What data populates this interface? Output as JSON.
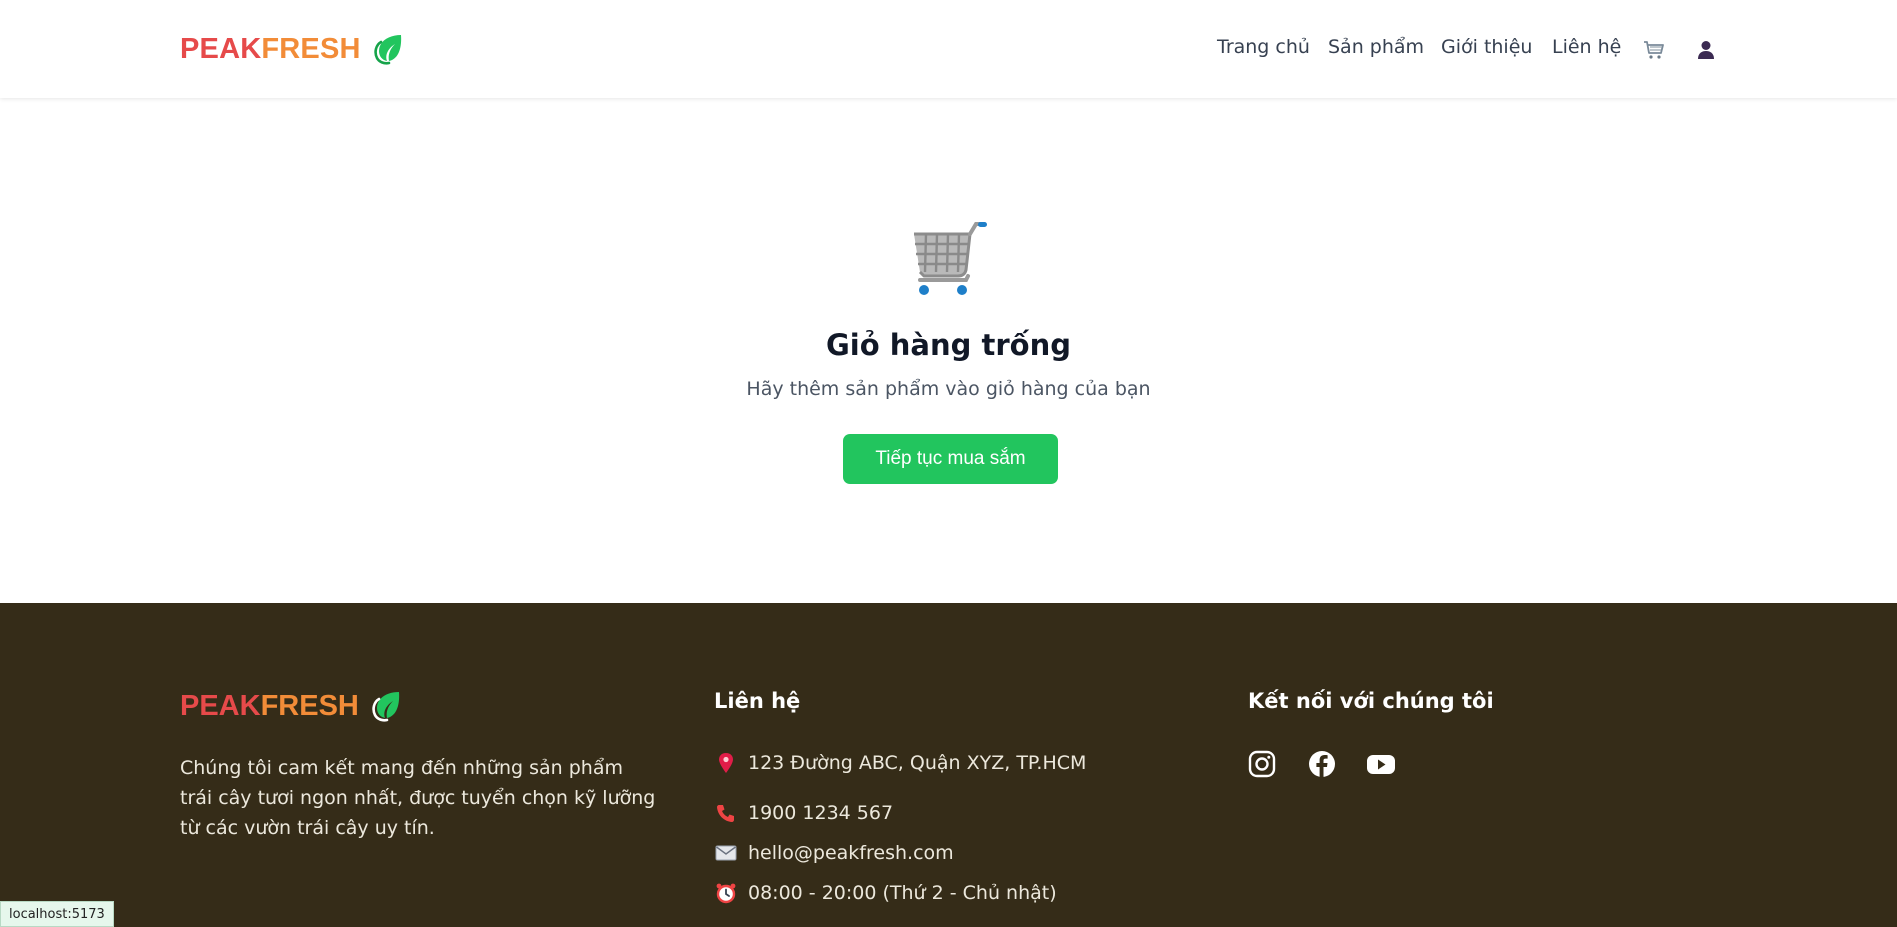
{
  "header": {
    "logo_part1": "PEAK",
    "logo_part2": "FRESH",
    "nav": [
      {
        "label": "Trang chủ"
      },
      {
        "label": "Sản phẩm"
      },
      {
        "label": "Giới thiệu"
      },
      {
        "label": "Liên hệ"
      }
    ],
    "icons": [
      "cart-icon",
      "user-icon"
    ]
  },
  "empty_cart": {
    "title": "Giỏ hàng trống",
    "subtitle": "Hãy thêm sản phẩm vào giỏ hàng của bạn",
    "button_label": "Tiếp tục mua sắm"
  },
  "footer": {
    "logo_part1": "PEAK",
    "logo_part2": "FRESH",
    "description": "Chúng tôi cam kết mang đến những sản phẩm trái cây tươi ngon nhất, được tuyển chọn kỹ lưỡng từ các vườn trái cây uy tín.",
    "contact_heading": "Liên hệ",
    "contact": [
      {
        "icon": "pin-icon",
        "text": "123 Đường ABC, Quận XYZ, TP.HCM"
      },
      {
        "icon": "phone-icon",
        "text": "1900 1234 567"
      },
      {
        "icon": "mail-icon",
        "text": "hello@peakfresh.com"
      },
      {
        "icon": "clock-icon",
        "text": "08:00 - 20:00 (Thứ 2 - Chủ nhật)"
      }
    ],
    "social_heading": "Kết nối với chúng tôi",
    "social": [
      "instagram-icon",
      "facebook-icon",
      "youtube-icon"
    ]
  },
  "status_bar": {
    "url": "localhost:5173"
  },
  "colors": {
    "brand_red": "#e64a4a",
    "brand_orange": "#f28c38",
    "accent_green": "#22c55e",
    "footer_bg": "#352c18"
  }
}
